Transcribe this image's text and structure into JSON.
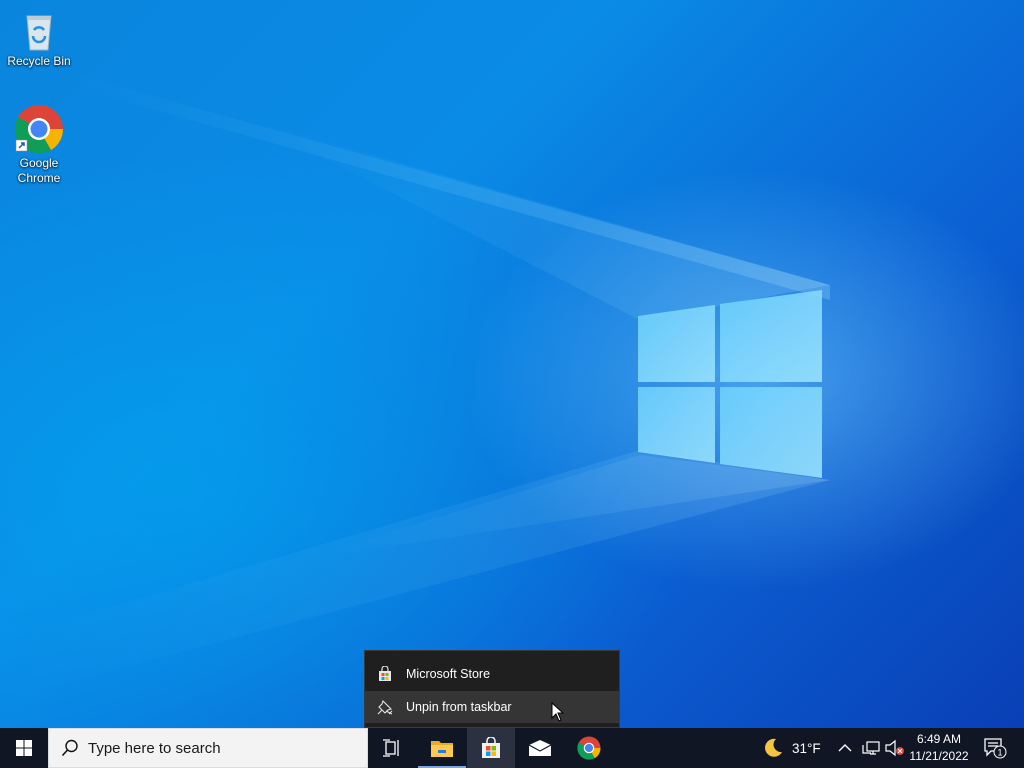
{
  "desktop": {
    "icons": [
      {
        "label": "Recycle Bin",
        "icon": "recycle-bin-icon"
      },
      {
        "label": "Google\nChrome",
        "icon": "chrome-icon"
      }
    ]
  },
  "context_menu": {
    "items": [
      {
        "label": "Microsoft Store",
        "icon": "store-icon"
      },
      {
        "label": "Unpin from taskbar",
        "icon": "unpin-icon"
      }
    ]
  },
  "taskbar": {
    "search_placeholder": "Type here to search",
    "apps": [
      "task-view-icon",
      "file-explorer-icon",
      "microsoft-store-icon",
      "mail-icon",
      "chrome-icon"
    ],
    "weather": {
      "temp": "31°F",
      "icon": "moon-icon"
    },
    "clock": {
      "time": "6:49 AM",
      "date": "11/21/2022"
    },
    "notifications": {
      "count": "1"
    }
  },
  "colors": {
    "taskbar": "#101624",
    "menu": "#1f1f1f",
    "menu_hover": "#353535",
    "accent": "#0a63d3"
  }
}
